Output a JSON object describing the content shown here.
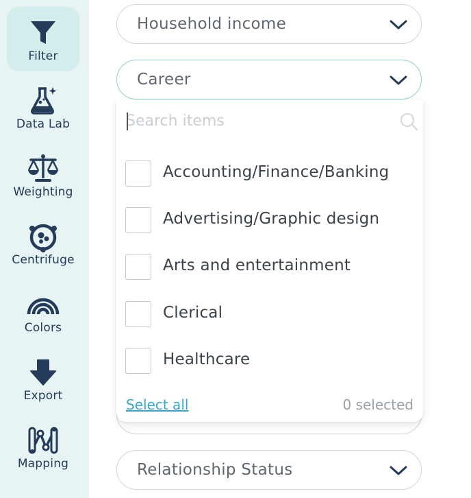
{
  "sidebar": {
    "items": [
      {
        "label": "Filter",
        "icon": "filter-icon",
        "active": true
      },
      {
        "label": "Data Lab",
        "icon": "flask-icon"
      },
      {
        "label": "Weighting",
        "icon": "scale-icon"
      },
      {
        "label": "Centrifuge",
        "icon": "centrifuge-icon"
      },
      {
        "label": "Colors",
        "icon": "rainbow-icon"
      },
      {
        "label": "Export",
        "icon": "download-arrow-icon"
      },
      {
        "label": "Mapping",
        "icon": "mapping-icon"
      }
    ],
    "colors": {
      "background": "#e8f3f3",
      "active": "#d3ecec",
      "icon": "#243c5a"
    }
  },
  "filters": {
    "household_income": {
      "value": "Household income"
    },
    "career": {
      "value": "Career",
      "search_placeholder": "Search items",
      "options": [
        "Accounting/Finance/Banking",
        "Advertising/Graphic design",
        "Arts and entertainment",
        "Clerical",
        "Healthcare"
      ],
      "select_all_label": "Select all",
      "selected_count": "0 selected"
    },
    "relationship_status": {
      "value": "Relationship Status"
    }
  },
  "colors": {
    "accent": "#3ca5cc",
    "open_border": "#8fcfc9"
  }
}
